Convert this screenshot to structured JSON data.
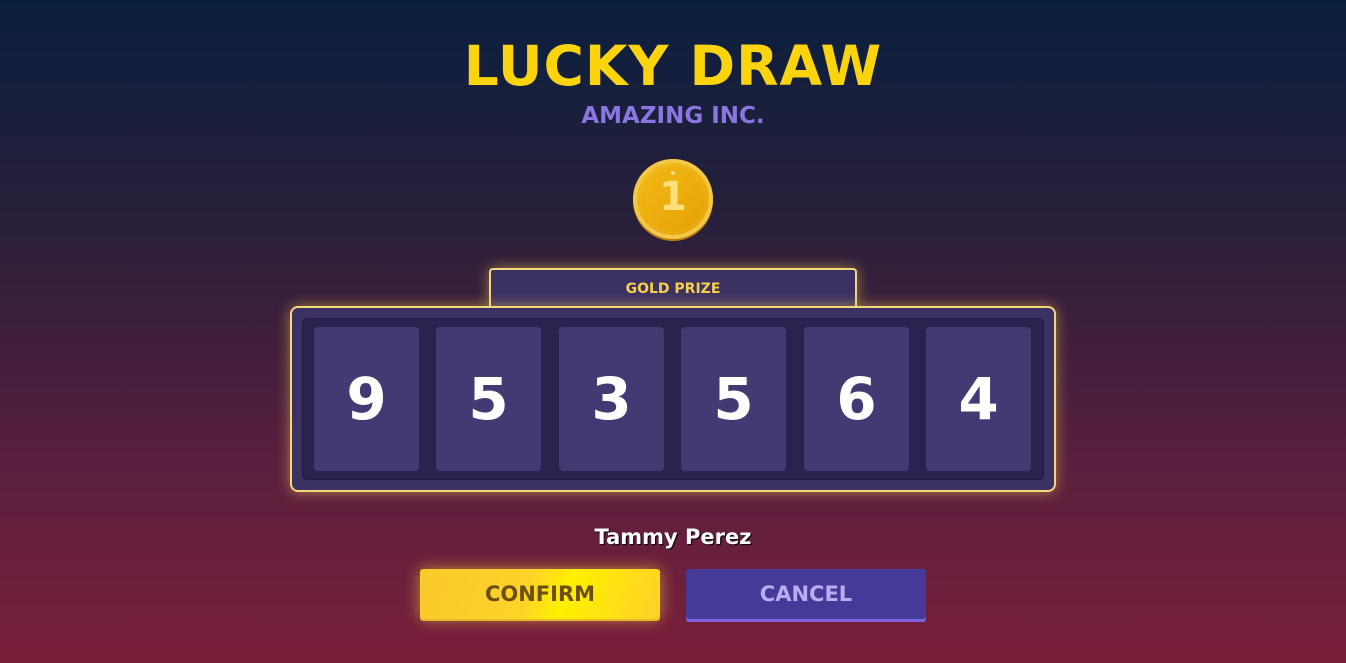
{
  "header": {
    "title": "LUCKY DRAW",
    "subtitle": "AMAZING INC."
  },
  "prize": {
    "rank_badge": "1",
    "label": "GOLD PRIZE"
  },
  "digits": [
    "9",
    "5",
    "3",
    "5",
    "6",
    "4"
  ],
  "winner": {
    "name": "Tammy Perez"
  },
  "actions": {
    "confirm_label": "CONFIRM",
    "cancel_label": "CANCEL"
  },
  "colors": {
    "title": "#fcd40d",
    "subtitle": "#8b75e0",
    "panel_border": "#f3d77a",
    "confirm_bg": "#fcd428",
    "cancel_bg": "#463a98"
  },
  "icons": {
    "coin": "gold-coin-icon"
  }
}
